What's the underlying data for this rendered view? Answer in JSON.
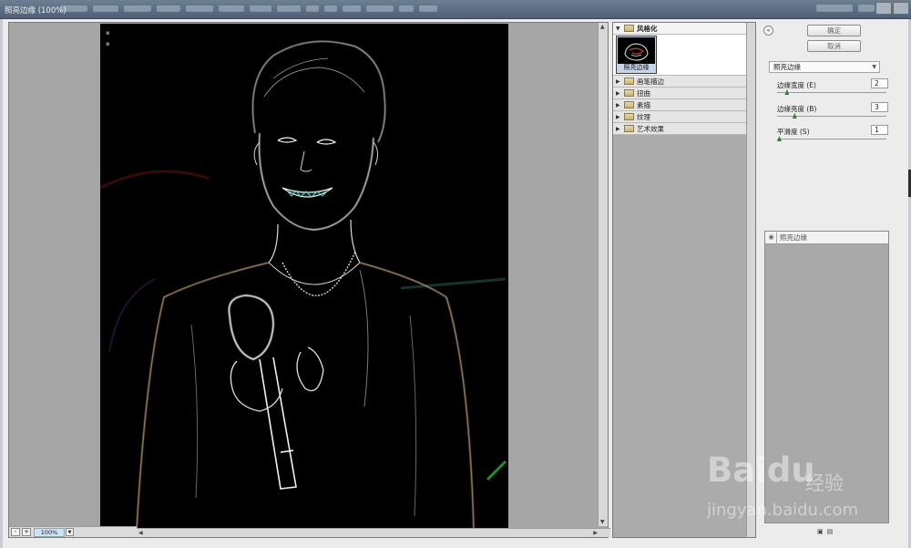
{
  "window": {
    "title": "照亮边缘 (100%)"
  },
  "preview": {
    "zoom": "100%",
    "zoom_out": "-",
    "zoom_in": "+"
  },
  "gallery": {
    "open_category": "风格化",
    "selected_filter": "照亮边缘",
    "categories": [
      "画笔描边",
      "扭曲",
      "素描",
      "纹理",
      "艺术效果"
    ]
  },
  "controls": {
    "ok_label": "确定",
    "cancel_label": "取消",
    "filter_select": "照亮边缘",
    "params": [
      {
        "label": "边缘宽度 (E)",
        "value": "2",
        "fraction": 0.07
      },
      {
        "label": "边缘亮度 (B)",
        "value": "3",
        "fraction": 0.14
      },
      {
        "label": "平滑度 (S)",
        "value": "1",
        "fraction": 0.0
      }
    ]
  },
  "layers": {
    "items": [
      "照亮边缘"
    ]
  },
  "watermark": {
    "logo_text": "Baidu",
    "cn_text": "经验",
    "url": "jingyan.baidu.com"
  }
}
